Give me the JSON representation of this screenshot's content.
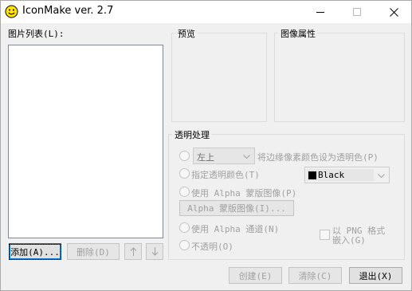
{
  "window": {
    "title": "IconMake ver. 2.7",
    "minimize_icon": "minimize-icon",
    "maximize_icon": "maximize-icon",
    "close_icon": "close-icon"
  },
  "image_list": {
    "label": "图片列表(L):",
    "add_button": "添加(A)...",
    "delete_button": "删除(D)",
    "up_icon": "arrow-up-icon",
    "down_icon": "arrow-down-icon"
  },
  "preview": {
    "title": "预览"
  },
  "properties": {
    "title": "图像属性"
  },
  "transparency": {
    "title": "透明处理",
    "position_select": {
      "value": "左上"
    },
    "option_edge_pixel": "将边缘像素颜色设为透明色(P)",
    "option_specify_color": "指定透明颜色(T)",
    "color_select": {
      "value": "Black",
      "swatch_color": "#000000"
    },
    "option_alpha_mask": "使用 Alpha 蒙版图像(P)",
    "alpha_mask_button": "Alpha 蒙版图像(I)...",
    "option_alpha_channel": "使用 Alpha 通道(N)",
    "png_embed_line1": "以 PNG 格式",
    "png_embed_line2": "嵌入(G)",
    "option_opaque": "不透明(O)"
  },
  "footer": {
    "create_button": "创建(E)",
    "clear_button": "清除(C)",
    "exit_button": "退出(X)"
  }
}
